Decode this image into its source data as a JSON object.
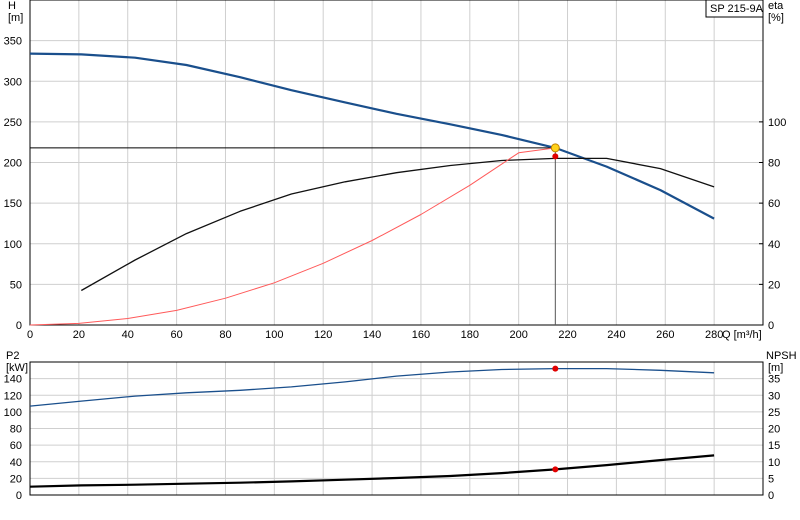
{
  "chart_data": [
    {
      "type": "line",
      "title": "SP 215-9A",
      "xlabel": "Q [m³/h]",
      "ylabel_left": [
        "H",
        "[m]"
      ],
      "ylabel_right": [
        "eta",
        "[%]"
      ],
      "xlim": [
        0,
        300
      ],
      "ylim_left": [
        0,
        400
      ],
      "ylim_right": [
        0,
        160
      ],
      "x_ticks": [
        0,
        20,
        40,
        60,
        80,
        100,
        120,
        140,
        160,
        180,
        200,
        220,
        240,
        260,
        280
      ],
      "y_ticks_left": [
        0,
        50,
        100,
        150,
        200,
        250,
        300,
        350
      ],
      "y_ticks_right": [
        0,
        20,
        40,
        60,
        80,
        100
      ],
      "grid": true,
      "series": [
        {
          "key": "head",
          "axis": "left",
          "color": "#1a4f8c",
          "width": 2.2,
          "x": [
            0,
            21,
            43,
            64,
            86,
            107,
            129,
            150,
            172,
            193,
            215,
            236,
            258,
            280
          ],
          "y": [
            334,
            333,
            329,
            320,
            305,
            289,
            274,
            260,
            247,
            234,
            218,
            195,
            166,
            131
          ]
        },
        {
          "key": "eta",
          "axis": "right",
          "color": "#111111",
          "width": 1.3,
          "x": [
            21,
            43,
            64,
            86,
            107,
            129,
            150,
            172,
            193,
            215,
            236,
            258,
            280
          ],
          "y": [
            17,
            32,
            45,
            56,
            64.5,
            70.5,
            75,
            78.5,
            81,
            82,
            82,
            77,
            68
          ]
        },
        {
          "key": "system-curve",
          "axis": "left",
          "color": "#ff5a5a",
          "width": 1,
          "x": [
            0,
            20,
            40,
            60,
            80,
            100,
            120,
            140,
            160,
            180,
            200,
            215
          ],
          "y": [
            0,
            2,
            8,
            18,
            33,
            52,
            76,
            104,
            136,
            172,
            212,
            218
          ]
        }
      ],
      "duty_point": {
        "x": 215,
        "head": 218,
        "eta": 83
      }
    },
    {
      "type": "line",
      "ylabel_left": [
        "P2",
        "[kW]"
      ],
      "ylabel_right": [
        "NPSH",
        "[m]"
      ],
      "xlim": [
        0,
        300
      ],
      "ylim_left": [
        0,
        160
      ],
      "ylim_right": [
        0,
        40
      ],
      "y_ticks_left": [
        0,
        20,
        40,
        60,
        80,
        100,
        120,
        140
      ],
      "y_ticks_right": [
        0,
        5,
        10,
        15,
        20,
        25,
        30,
        35
      ],
      "grid": true,
      "series": [
        {
          "key": "p2",
          "axis": "left",
          "color": "#1a4f8c",
          "width": 1.3,
          "x": [
            0,
            21,
            43,
            64,
            86,
            107,
            129,
            150,
            172,
            193,
            215,
            236,
            258,
            280
          ],
          "y": [
            107,
            113,
            119,
            123,
            126,
            130,
            136,
            143,
            148,
            151,
            152,
            152,
            150,
            147
          ]
        },
        {
          "key": "npsh",
          "axis": "right",
          "color": "#000000",
          "width": 2.2,
          "x": [
            0,
            21,
            43,
            64,
            86,
            107,
            129,
            150,
            172,
            193,
            215,
            236,
            258,
            280
          ],
          "y": [
            2.5,
            2.9,
            3.1,
            3.4,
            3.7,
            4.1,
            4.6,
            5.1,
            5.7,
            6.6,
            7.7,
            9.0,
            10.5,
            11.9
          ]
        }
      ],
      "duty_point": {
        "x": 215,
        "p2": 152,
        "npsh": 7.7
      }
    }
  ]
}
